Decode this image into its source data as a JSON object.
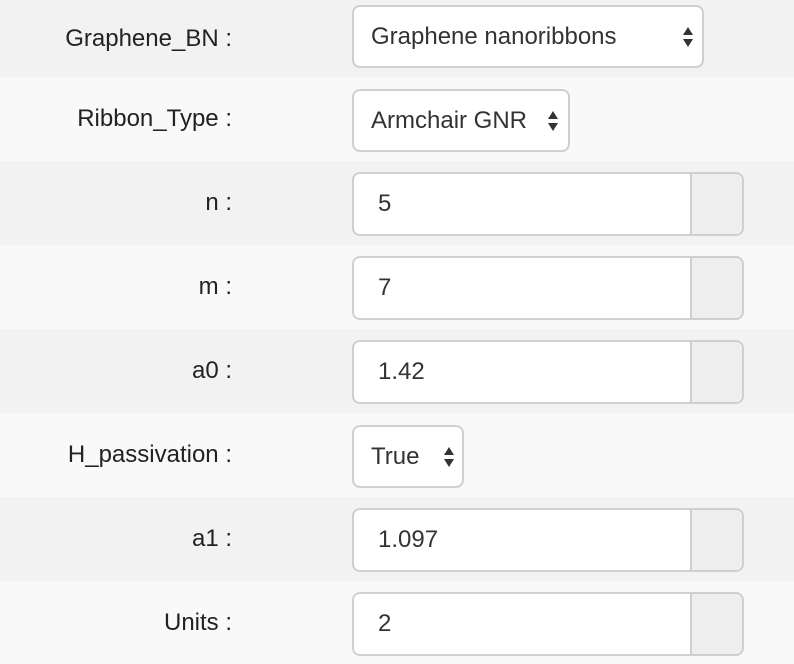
{
  "form": {
    "graphene_bn": {
      "label": "Graphene_BN :",
      "value": "Graphene nanoribbons"
    },
    "ribbon_type": {
      "label": "Ribbon_Type :",
      "value": "Armchair GNR"
    },
    "n": {
      "label": "n :",
      "value": "5"
    },
    "m": {
      "label": "m :",
      "value": "7"
    },
    "a0": {
      "label": "a0 :",
      "value": "1.42"
    },
    "h_passivation": {
      "label": "H_passivation :",
      "value": "True"
    },
    "a1": {
      "label": "a1 :",
      "value": "1.097"
    },
    "units": {
      "label": "Units :",
      "value": "2"
    }
  }
}
